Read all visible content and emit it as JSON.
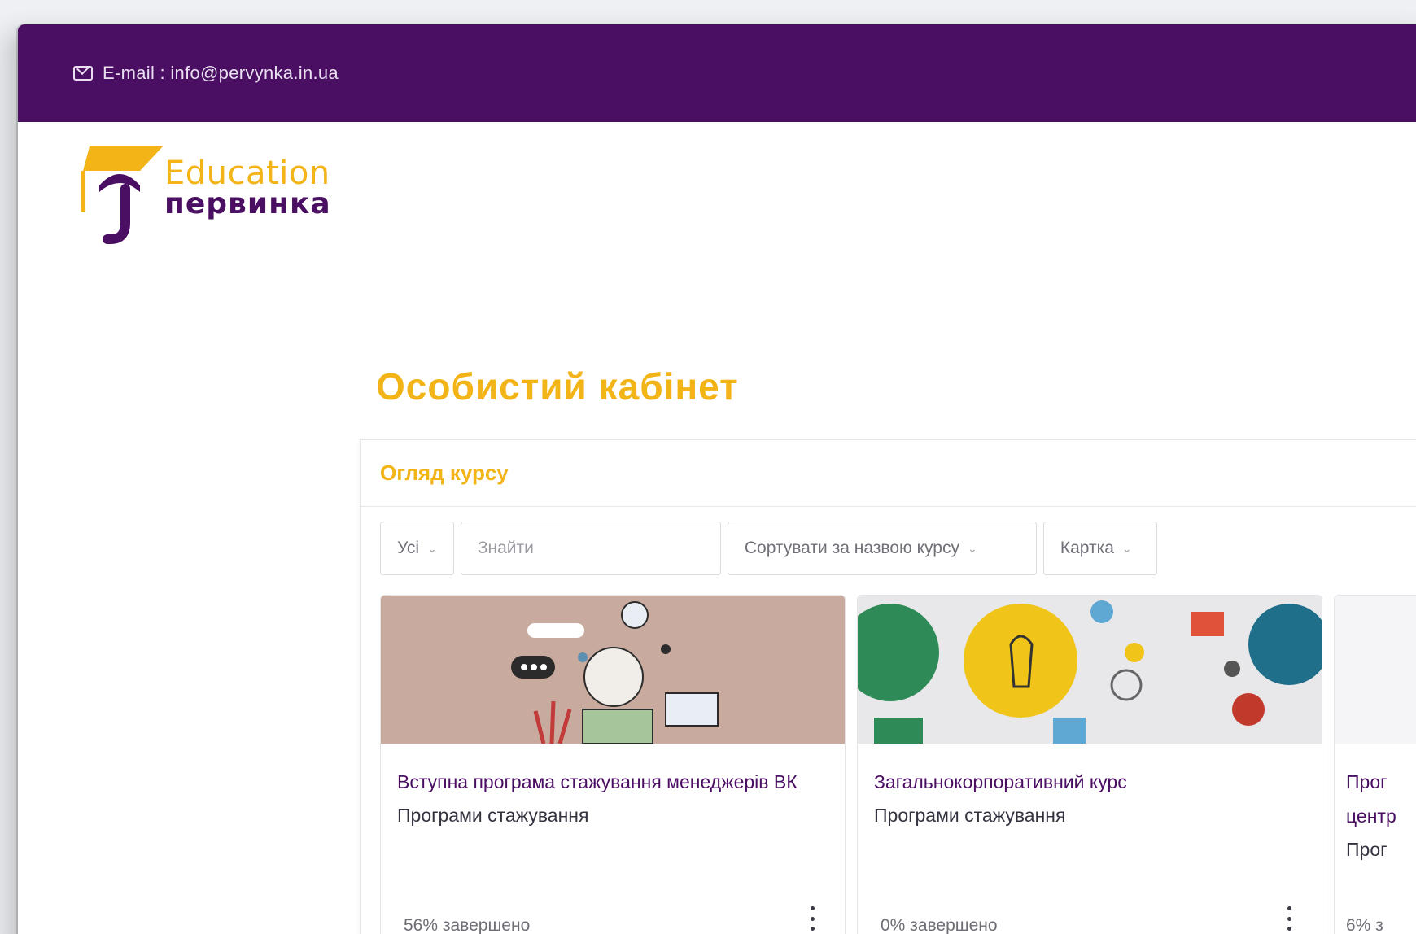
{
  "topbar": {
    "email_text": "E-mail : info@pervynka.in.ua"
  },
  "logo": {
    "line1": "Education",
    "line2": "первинка"
  },
  "page": {
    "title": "Особистий кабінет"
  },
  "panel": {
    "header": "Огляд курсу",
    "filters": {
      "grouping": "Усі",
      "search_placeholder": "Знайти",
      "sort": "Сортувати за назвою курсу",
      "view": "Картка"
    }
  },
  "courses": [
    {
      "title": "Вступна програма стажування менеджерів ВК",
      "category": "Програми стажування",
      "progress_text": "56% завершено",
      "progress_value": 56
    },
    {
      "title": "Загальнокорпоративний курс",
      "category": "Програми стажування",
      "progress_text": "0% завершено",
      "progress_value": 0
    },
    {
      "title": "Прог",
      "title_line2": "центр",
      "category": "Прог",
      "progress_text": "6% з",
      "progress_value": 6
    }
  ],
  "colors": {
    "brand_purple": "#4a0f62",
    "brand_yellow": "#f2b417"
  }
}
